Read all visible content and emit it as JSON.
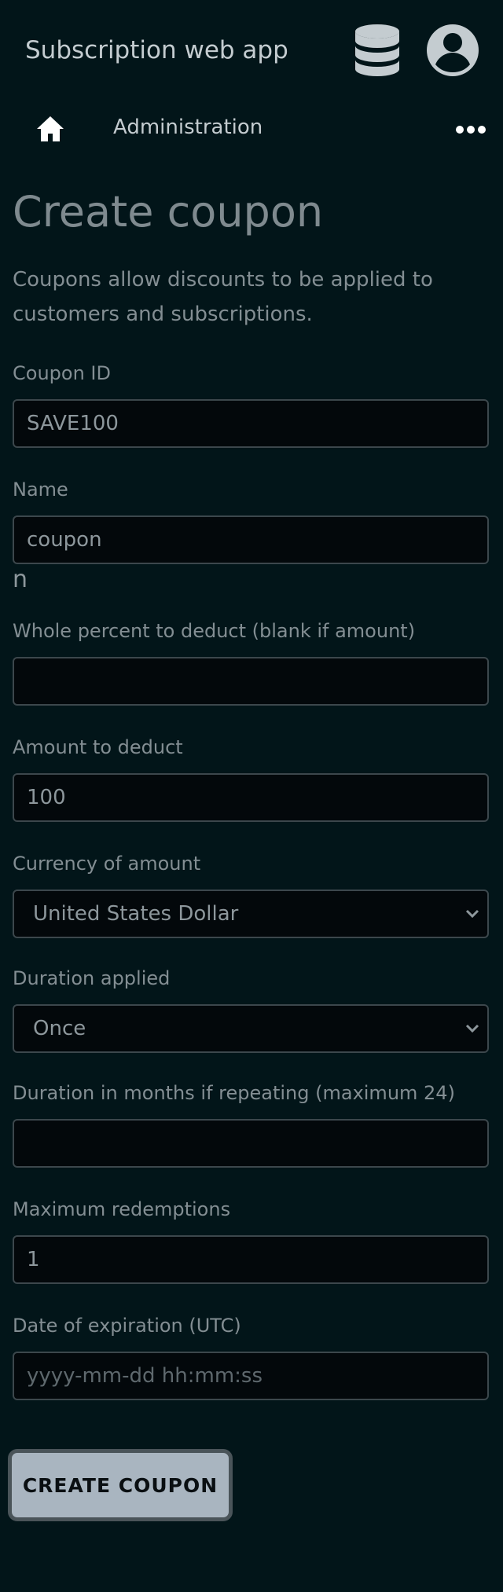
{
  "app": {
    "title": "Subscription web app",
    "icons": {
      "database": "database-icon",
      "account": "account-circle-icon"
    }
  },
  "nav": {
    "home_icon": "home-icon",
    "section": "Administration",
    "more_icon": "more-horizontal-icon"
  },
  "page": {
    "title": "Create coupon",
    "description": "Coupons allow discounts to be applied to customers and subscriptions."
  },
  "form": {
    "coupon_id": {
      "label": "Coupon ID",
      "value": "SAVE100",
      "placeholder": ""
    },
    "name": {
      "label": "Name",
      "value": "coupon",
      "placeholder": ""
    },
    "stray_text": "n",
    "percent_off": {
      "label": "Whole percent to deduct (blank if amount)",
      "value": "",
      "placeholder": ""
    },
    "amount_off": {
      "label": "Amount to deduct",
      "value": "100",
      "placeholder": ""
    },
    "currency": {
      "label": "Currency of amount",
      "selected": "United States Dollar"
    },
    "duration": {
      "label": "Duration applied",
      "selected": "Once"
    },
    "duration_months": {
      "label": "Duration in months if repeating (maximum 24)",
      "value": "",
      "placeholder": ""
    },
    "max_redemptions": {
      "label": "Maximum redemptions",
      "value": "1",
      "placeholder": ""
    },
    "expiration": {
      "label": "Date of expiration (UTC)",
      "value": "",
      "placeholder": "yyyy-mm-dd hh:mm:ss"
    },
    "submit_label": "CREATE COUPON"
  },
  "colors": {
    "background": "#021519",
    "input_background": "#03080b",
    "button": "#a9b5c0"
  }
}
